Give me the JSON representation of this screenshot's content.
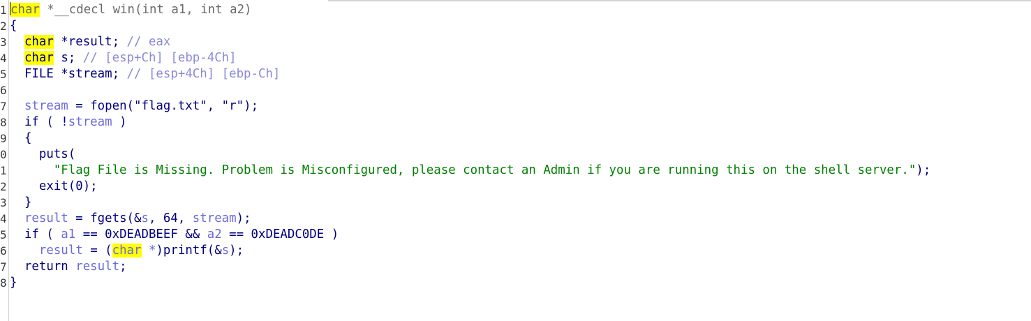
{
  "editor": {
    "lines": [
      {
        "num": "1",
        "tokens": [
          {
            "t": "char",
            "c": "sig hl",
            "name": "keyword-char"
          },
          {
            "t": " *__cdecl win(int a1, int a2)",
            "c": "sig",
            "name": "function-signature"
          }
        ]
      },
      {
        "num": "2",
        "tokens": [
          {
            "t": "{",
            "c": "plain",
            "name": "brace"
          }
        ]
      },
      {
        "num": "3",
        "tokens": [
          {
            "t": "  ",
            "c": "plain",
            "name": "indent"
          },
          {
            "t": "char",
            "c": "plain hl",
            "name": "keyword-char"
          },
          {
            "t": " *result; ",
            "c": "plain",
            "name": "code-text"
          },
          {
            "t": "// eax",
            "c": "cm",
            "name": "comment"
          }
        ]
      },
      {
        "num": "4",
        "tokens": [
          {
            "t": "  ",
            "c": "plain",
            "name": "indent"
          },
          {
            "t": "char",
            "c": "plain hl",
            "name": "keyword-char"
          },
          {
            "t": " s; ",
            "c": "plain",
            "name": "code-text"
          },
          {
            "t": "// [esp+Ch] [ebp-4Ch]",
            "c": "cm",
            "name": "comment"
          }
        ]
      },
      {
        "num": "5",
        "tokens": [
          {
            "t": "  FILE *stream; ",
            "c": "plain",
            "name": "code-text"
          },
          {
            "t": "// [esp+4Ch] [ebp-Ch]",
            "c": "cm",
            "name": "comment"
          }
        ]
      },
      {
        "num": "6",
        "tokens": []
      },
      {
        "num": "7",
        "tokens": [
          {
            "t": "  ",
            "c": "plain",
            "name": "indent"
          },
          {
            "t": "stream",
            "c": "var",
            "name": "variable"
          },
          {
            "t": " = fopen(",
            "c": "plain",
            "name": "code-text"
          },
          {
            "t": "\"flag.txt\"",
            "c": "plain",
            "name": "string"
          },
          {
            "t": ", ",
            "c": "plain",
            "name": "code-text"
          },
          {
            "t": "\"r\"",
            "c": "plain",
            "name": "string"
          },
          {
            "t": ");",
            "c": "plain",
            "name": "code-text"
          }
        ]
      },
      {
        "num": "8",
        "tokens": [
          {
            "t": "  if ( !",
            "c": "plain",
            "name": "code-text"
          },
          {
            "t": "stream",
            "c": "var",
            "name": "variable"
          },
          {
            "t": " )",
            "c": "plain",
            "name": "code-text"
          }
        ]
      },
      {
        "num": "9",
        "tokens": [
          {
            "t": "  {",
            "c": "plain",
            "name": "brace"
          }
        ]
      },
      {
        "num": "0",
        "tokens": [
          {
            "t": "    puts(",
            "c": "plain",
            "name": "code-text"
          }
        ]
      },
      {
        "num": "1",
        "tokens": [
          {
            "t": "      ",
            "c": "plain",
            "name": "indent"
          },
          {
            "t": "\"Flag File is Missing. Problem is Misconfigured, please contact an Admin if you are running this on the shell server.\"",
            "c": "str",
            "name": "string-literal"
          },
          {
            "t": ");",
            "c": "plain",
            "name": "code-text"
          }
        ]
      },
      {
        "num": "2",
        "tokens": [
          {
            "t": "    exit(0);",
            "c": "plain",
            "name": "code-text"
          }
        ]
      },
      {
        "num": "3",
        "tokens": [
          {
            "t": "  }",
            "c": "plain",
            "name": "brace"
          }
        ]
      },
      {
        "num": "4",
        "tokens": [
          {
            "t": "  ",
            "c": "plain",
            "name": "indent"
          },
          {
            "t": "result",
            "c": "var",
            "name": "variable"
          },
          {
            "t": " = fgets(&",
            "c": "plain",
            "name": "code-text"
          },
          {
            "t": "s",
            "c": "var",
            "name": "variable"
          },
          {
            "t": ", 64, ",
            "c": "plain",
            "name": "code-text"
          },
          {
            "t": "stream",
            "c": "var",
            "name": "variable"
          },
          {
            "t": ");",
            "c": "plain",
            "name": "code-text"
          }
        ]
      },
      {
        "num": "5",
        "tokens": [
          {
            "t": "  if ( ",
            "c": "plain",
            "name": "code-text"
          },
          {
            "t": "a1",
            "c": "var",
            "name": "variable"
          },
          {
            "t": " == 0xDEADBEEF && ",
            "c": "plain",
            "name": "code-text"
          },
          {
            "t": "a2",
            "c": "var",
            "name": "variable"
          },
          {
            "t": " == 0xDEADC0DE )",
            "c": "plain",
            "name": "code-text"
          }
        ]
      },
      {
        "num": "6",
        "tokens": [
          {
            "t": "    ",
            "c": "plain",
            "name": "indent"
          },
          {
            "t": "result",
            "c": "var",
            "name": "variable"
          },
          {
            "t": " = (",
            "c": "plain",
            "name": "code-text"
          },
          {
            "t": "char",
            "c": "var hl",
            "name": "keyword-char"
          },
          {
            "t": " *",
            "c": "var",
            "name": "code-text"
          },
          {
            "t": ")printf(&",
            "c": "plain",
            "name": "code-text"
          },
          {
            "t": "s",
            "c": "var",
            "name": "variable"
          },
          {
            "t": ");",
            "c": "plain",
            "name": "code-text"
          }
        ]
      },
      {
        "num": "7",
        "tokens": [
          {
            "t": "  return ",
            "c": "plain",
            "name": "code-text"
          },
          {
            "t": "result",
            "c": "var",
            "name": "variable"
          },
          {
            "t": ";",
            "c": "plain",
            "name": "code-text"
          }
        ]
      },
      {
        "num": "8",
        "tokens": [
          {
            "t": "}",
            "c": "plain",
            "name": "brace"
          }
        ]
      }
    ]
  },
  "colors": {
    "keyword": "#000080",
    "variable": "#6a6add",
    "comment": "#8a8ad8",
    "string": "#008000",
    "highlight": "#ffff00"
  }
}
